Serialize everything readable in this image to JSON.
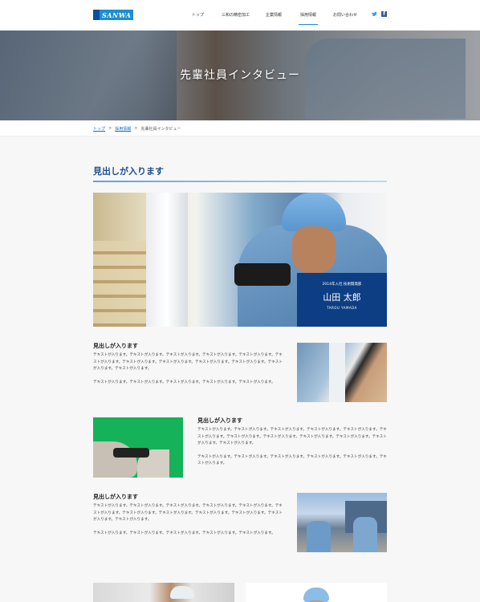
{
  "header": {
    "logo_text": "SANWA",
    "nav": [
      "トップ",
      "三和の精密加工",
      "企業情報",
      "採用情報",
      "お問い合わせ"
    ],
    "active_nav": "採用情報",
    "social": {
      "twitter_icon": "twitter-icon",
      "facebook_icon": "facebook-icon",
      "facebook_glyph": "f"
    }
  },
  "hero": {
    "title": "先輩社員インタビュー"
  },
  "breadcrumb": {
    "items": [
      "トップ",
      "採用情報",
      "先輩社員インタビュー"
    ],
    "separator": ">"
  },
  "section": {
    "title": "見出しが入ります"
  },
  "profile": {
    "meta": "2014年入社 技術開発部",
    "name": "山田 太郎",
    "roman": "TAROU YAMADA"
  },
  "blocks": [
    {
      "heading": "見出しが入ります",
      "paragraphs": [
        "テキストが入ります。テキストが入ります。テキストが入ります。テキストが入ります。テキストが入ります。テキストが入ります。テキストが入ります。テキストが入ります。テキストが入ります。テキストが入ります。テキストが入ります。テキストが入ります。",
        "テキストが入ります。テキストが入ります。テキストが入ります。テキストが入ります。テキストが入ります。"
      ]
    },
    {
      "heading": "見出しが入ります",
      "paragraphs": [
        "テキストが入ります。テキストが入ります。テキストが入ります。テキストが入ります。テキストが入ります。テキストが入ります。テキストが入ります。テキストが入ります。テキストが入ります。テキストが入ります。テキストが入ります。テキストが入ります。",
        "テキストが入ります。テキストが入ります。テキストが入ります。テキストが入ります。テキストが入ります。テキストが入ります。"
      ]
    },
    {
      "heading": "見出しが入ります",
      "paragraphs": [
        "テキストが入ります。テキストが入ります。テキストが入ります。テキストが入ります。テキストが入ります。テキストが入ります。テキストが入ります。テキストが入ります。テキストが入ります。テキストが入ります。テキストが入ります。テキストが入ります。",
        "テキストが入ります。テキストが入ります。テキストが入ります。テキストが入ります。テキストが入ります。"
      ]
    }
  ],
  "colors": {
    "brand": "#1a8fd0",
    "title_blue": "#1b4f8f",
    "card_navy": "#0d3e84"
  }
}
